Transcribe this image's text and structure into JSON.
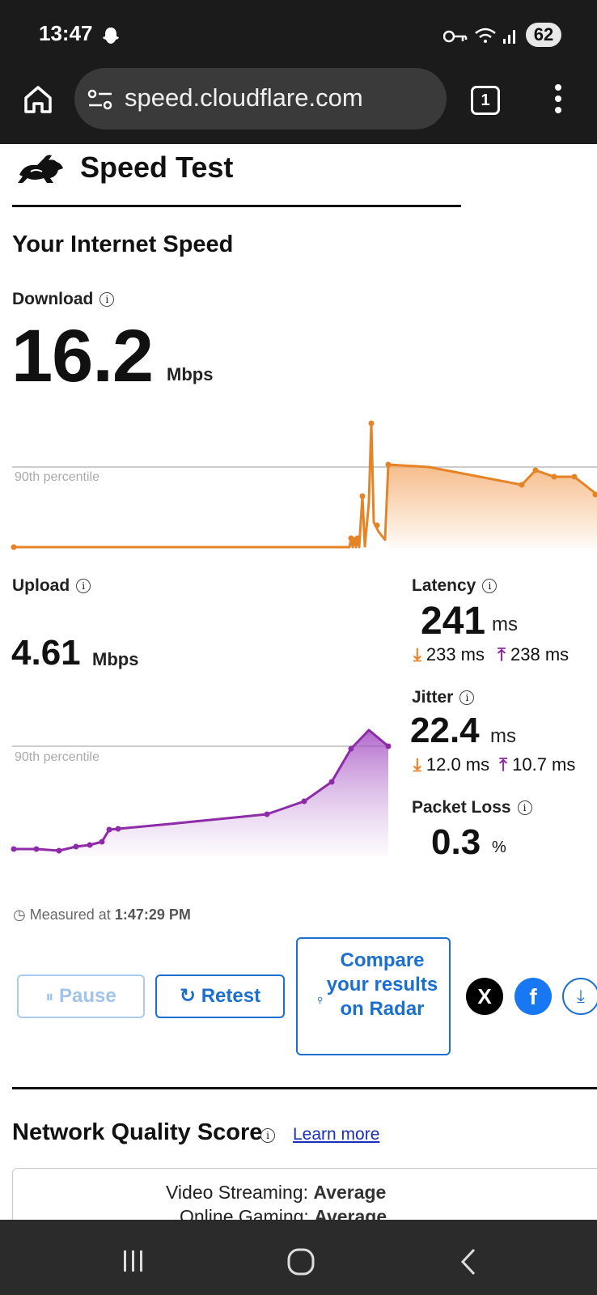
{
  "status_bar": {
    "time": "13:47",
    "battery": "62"
  },
  "browser": {
    "url": "speed.cloudflare.com",
    "tab_count": "1"
  },
  "page": {
    "title": "Speed Test",
    "section_heading": "Your Internet Speed",
    "download": {
      "label": "Download",
      "value": "16.2",
      "unit": "Mbps",
      "percentile_label": "90th percentile"
    },
    "upload": {
      "label": "Upload",
      "value": "4.61",
      "unit": "Mbps",
      "percentile_label": "90th percentile"
    },
    "latency": {
      "label": "Latency",
      "value": "241",
      "unit": "ms",
      "down": "233 ms",
      "up": "238 ms"
    },
    "jitter": {
      "label": "Jitter",
      "value": "22.4",
      "unit": "ms",
      "down": "12.0 ms",
      "up": "10.7 ms"
    },
    "packet_loss": {
      "label": "Packet Loss",
      "value": "0.3",
      "unit": "%"
    },
    "measured": {
      "prefix": "Measured at",
      "time": "1:47:29 PM"
    },
    "buttons": {
      "pause": "Pause",
      "retest": "Retest",
      "compare": "Compare your results on Radar",
      "x_share": "X",
      "facebook_share": "f"
    },
    "nqs": {
      "title": "Network Quality Score",
      "learn_more": "Learn more",
      "rows": [
        {
          "label": "Video Streaming:",
          "value": "Average"
        },
        {
          "label": "Online Gaming:",
          "value": "Average"
        }
      ]
    }
  },
  "colors": {
    "download": "#e58326",
    "upload": "#8e2ba8",
    "link": "#1a6fd1"
  },
  "icons": [
    "home-icon",
    "site-info-icon",
    "tabs-icon",
    "more-icon",
    "rabbit-logo-icon",
    "info-icon",
    "clock-icon",
    "pause-icon",
    "retest-icon",
    "search-icon",
    "x-icon",
    "facebook-icon",
    "download-icon"
  ]
}
